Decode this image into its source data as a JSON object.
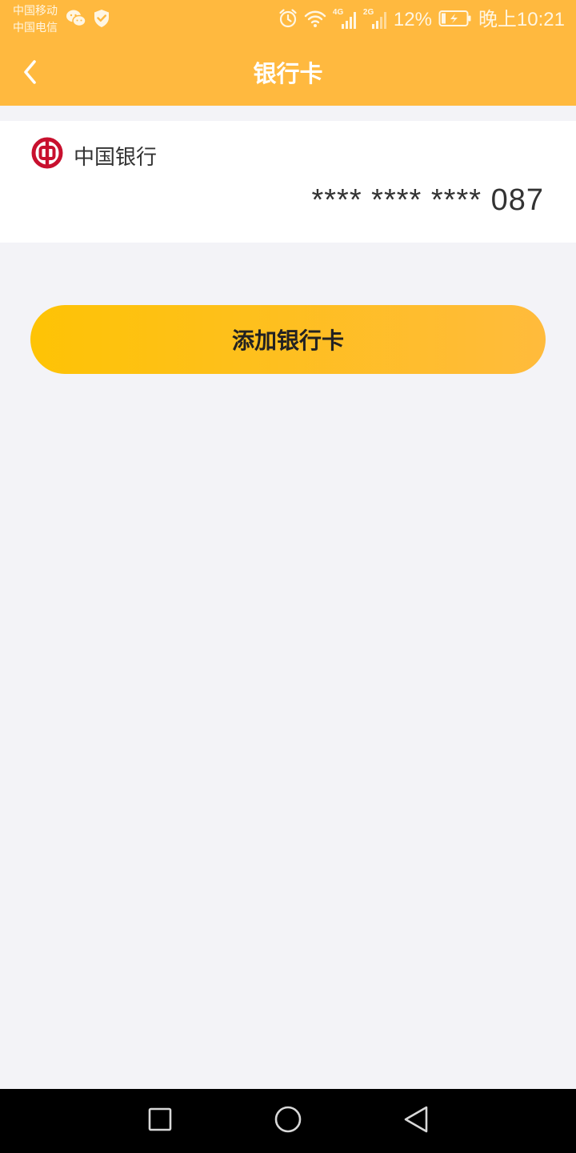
{
  "status_bar": {
    "carrier_1": "中国移动",
    "carrier_2": "中国电信",
    "network_1": "4G",
    "network_2": "2G",
    "battery": "12%",
    "time": "晚上10:21",
    "icons": [
      "wechat-icon",
      "shield-check-icon",
      "alarm-icon",
      "wifi-icon",
      "signal-icon",
      "signal-icon",
      "battery-charging-icon"
    ]
  },
  "header": {
    "title": "银行卡",
    "back_icon": "chevron-left-icon",
    "background_color": "#ffb93f"
  },
  "bank_cards": [
    {
      "bank_name": "中国银行",
      "logo_icon": "bank-of-china-logo",
      "logo_color": "#c8102e",
      "card_number": "**** **** **** 087"
    }
  ],
  "actions": {
    "add_card_label": "添加银行卡",
    "button_gradient": [
      "#fec305",
      "#ffbb3c"
    ]
  },
  "nav_bar": {
    "icons": [
      "recents-square-icon",
      "home-circle-icon",
      "back-triangle-icon"
    ]
  }
}
